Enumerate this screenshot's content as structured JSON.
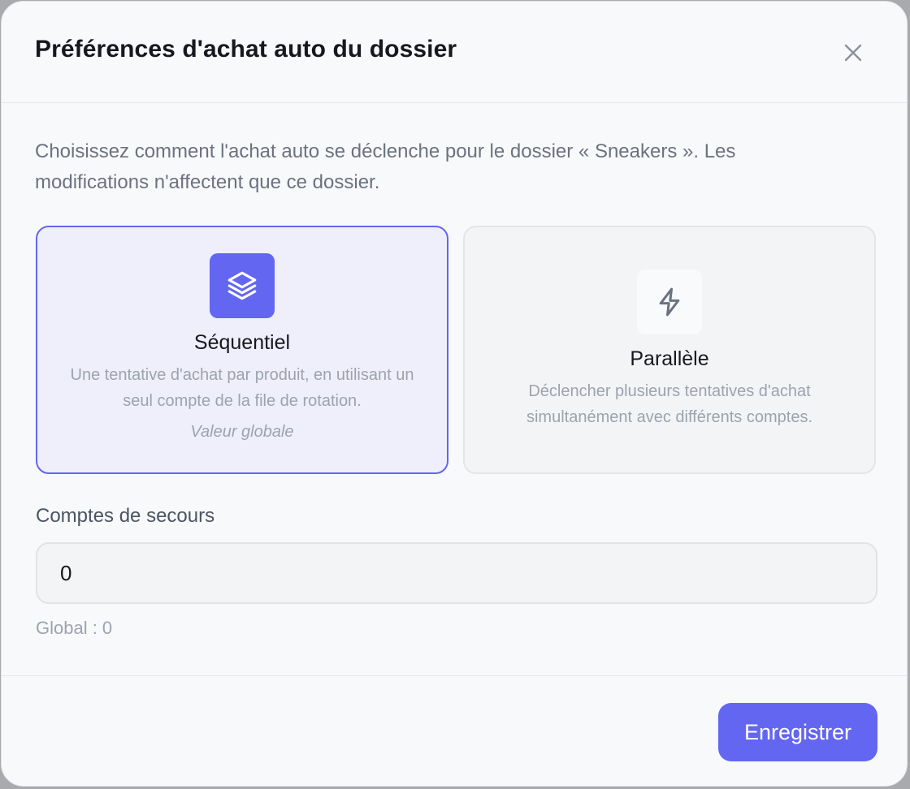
{
  "dialog": {
    "title": "Préférences d'achat auto du dossier",
    "close_icon": "close-icon",
    "description": "Choisissez comment l'achat auto se déclenche pour le dossier « Sneakers ». Les modifications n'affectent que ce dossier."
  },
  "modes": {
    "selected": "sequential",
    "sequential": {
      "icon": "layers-icon",
      "title": "Séquentiel",
      "text": "Une tentative d'achat par produit, en utilisant un seul compte de la file de rotation.",
      "note": "Valeur globale"
    },
    "parallel": {
      "icon": "lightning-icon",
      "title": "Parallèle",
      "text": "Déclencher plusieurs tentatives d'achat simultanément avec différents comptes."
    }
  },
  "backup_accounts": {
    "label": "Comptes de secours",
    "value": "0",
    "hint": "Global : 0"
  },
  "footer": {
    "save_label": "Enregistrer"
  },
  "colors": {
    "accent": "#6366f1",
    "selected_background": "#eeeffa"
  }
}
